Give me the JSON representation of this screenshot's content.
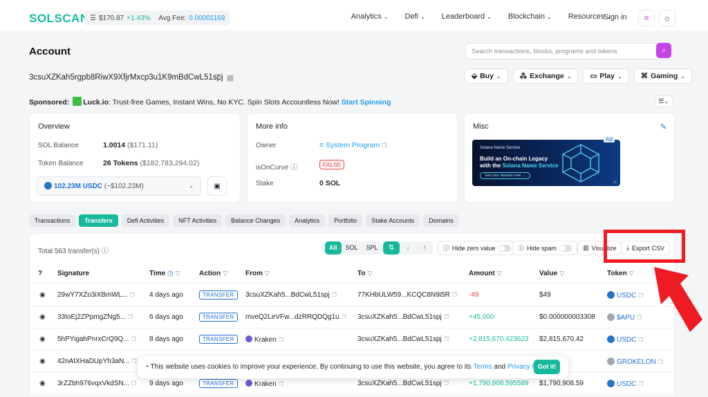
{
  "header": {
    "logo": "SOLSCAN",
    "sol_price": "$170.87",
    "sol_change": "+1.43%",
    "fee_label": "Avg Fee:",
    "fee_value": "0.00001169",
    "nav": [
      "Analytics",
      "Defi",
      "Leaderboard",
      "Blockchain",
      "Resources"
    ],
    "signin": "Sign in"
  },
  "page": {
    "title": "Account",
    "search_placeholder": "Search transactions, blocks, programs and tokens",
    "address": "3csuXZKah5rgpb8RiwX9XfjrMxcp3u1K9mBdCwL51spj",
    "actions": [
      "Buy",
      "Exchange",
      "Play",
      "Gaming"
    ]
  },
  "sponsored": {
    "label": "Sponsored:",
    "brand": "Luck.io",
    "text": ": Trust-free Games, Instant Wins, No KYC. Spin Slots Accountless Now!",
    "cta": "Start Spinning"
  },
  "overview": {
    "title": "Overview",
    "sol_label": "SOL Balance",
    "sol_value": "1.0014",
    "sol_usd": "($171.11)",
    "token_label": "Token Balance",
    "token_value": "26 Tokens",
    "token_usd": "($182,783,294.02)",
    "select_value": "102.23M USDC",
    "select_usd": "(~$102.23M)"
  },
  "more_info": {
    "title": "More info",
    "owner_label": "Owner",
    "owner_value": "System Program",
    "curve_label": "isOnCurve",
    "curve_value": "FALSE",
    "stake_label": "Stake",
    "stake_value": "0 SOL"
  },
  "misc": {
    "title": "Misc",
    "ad_brand": "Solana Name Service",
    "ad_line1": "Build an On-chain Legacy",
    "ad_line2_prefix": "with the ",
    "ad_line2_em": "Solana Name Service",
    "ad_button": "Get your domain now →",
    "ad_tag": "Ad"
  },
  "tabs": [
    "Transactions",
    "Transfers",
    "Defi Activities",
    "NFT Activities",
    "Balance Changes",
    "Analytics",
    "Portfolio",
    "Stake Accounts",
    "Domains"
  ],
  "table": {
    "total": "Total 563 transfer(s)",
    "filters": [
      "All",
      "SOL",
      "SPL"
    ],
    "hide_zero": "Hide zero value",
    "hide_spam": "Hide spam",
    "visualize": "Visualize",
    "export": "Export CSV",
    "columns": [
      "Signature",
      "Time",
      "Action",
      "From",
      "To",
      "Amount",
      "Value",
      "Token"
    ],
    "rows": [
      {
        "sig": "29wY7XZo3iXBmWL...",
        "time": "4 days ago",
        "action": "TRANSFER",
        "from": "3csuXZKah5...BdCwL51spj",
        "to": "77KHbULW59...KCQC8N9i5R",
        "amount": "-49",
        "value": "$49",
        "token": "USDC"
      },
      {
        "sig": "33toEj2ZPpmgZNg5...",
        "time": "6 days ago",
        "action": "TRANSFER",
        "from": "mveQ2LeVFw...dzRRQDQg1u",
        "to": "3csuXZKah5...BdCwL51spj",
        "amount": "+45,000",
        "value": "$0.000000003308",
        "token": "$APU"
      },
      {
        "sig": "5hPYigahPnrxCrQ9Q...",
        "time": "8 days ago",
        "action": "TRANSFER",
        "from": "Kraken",
        "to": "3csuXZKah5...BdCwL51spj",
        "amount": "+2,815,670.423623",
        "value": "$2,815,670.42",
        "token": "USDC"
      },
      {
        "sig": "42nAtXHaDUpYh3aN...",
        "time": "",
        "action": "",
        "from": "",
        "to": "",
        "amount": "",
        "value": "",
        "token": "GROKELON"
      },
      {
        "sig": "3rZZbh976vqxVkdSN...",
        "time": "9 days ago",
        "action": "TRANSFER",
        "from": "Kraken",
        "to": "3csuXZKah5...BdCwL51spj",
        "amount": "+1,790,908.595589",
        "value": "$1,790,908.59",
        "token": "USDC"
      }
    ]
  },
  "cookie": {
    "text": "This website uses cookies to improve your experience. By continuing to use this website, you agree to its ",
    "terms": "Terms",
    "and": " and ",
    "privacy": "Privacy Policy",
    "button": "Got it!"
  },
  "colors": {
    "accent": "#17b99d",
    "link": "#1d9bf0",
    "highlight": "#ef1c24"
  }
}
